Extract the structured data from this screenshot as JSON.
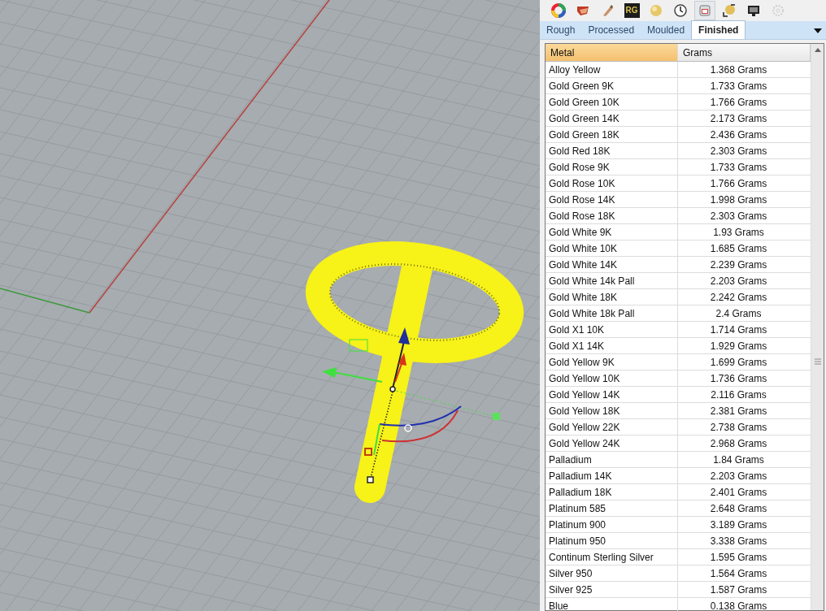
{
  "toolbar": [
    {
      "kind": "palette",
      "selected": false,
      "disabled": false
    },
    {
      "kind": "box",
      "selected": false,
      "disabled": false
    },
    {
      "kind": "brush",
      "selected": false,
      "disabled": false
    },
    {
      "kind": "logo",
      "label": "RG",
      "selected": false,
      "disabled": false
    },
    {
      "kind": "ball",
      "selected": false,
      "disabled": false
    },
    {
      "kind": "clock",
      "selected": false,
      "disabled": false
    },
    {
      "kind": "ring",
      "selected": true,
      "disabled": false
    },
    {
      "kind": "frame",
      "selected": false,
      "disabled": false
    },
    {
      "kind": "monitor",
      "selected": false,
      "disabled": false
    },
    {
      "kind": "gear",
      "selected": false,
      "disabled": true
    }
  ],
  "tabs": [
    {
      "label": "Rough",
      "selected": false
    },
    {
      "label": "Processed",
      "selected": false
    },
    {
      "label": "Moulded",
      "selected": false
    },
    {
      "label": "Finished",
      "selected": true
    }
  ],
  "table": {
    "columns": [
      {
        "label": "Metal",
        "sorted": true
      },
      {
        "label": "Grams",
        "sorted": false
      }
    ],
    "rows": [
      [
        "Alloy Yellow",
        "1.368 Grams"
      ],
      [
        "Gold Green 9K",
        "1.733 Grams"
      ],
      [
        "Gold Green 10K",
        "1.766 Grams"
      ],
      [
        "Gold Green 14K",
        "2.173 Grams"
      ],
      [
        "Gold Green 18K",
        "2.436 Grams"
      ],
      [
        "Gold Red 18K",
        "2.303 Grams"
      ],
      [
        "Gold Rose 9K",
        "1.733 Grams"
      ],
      [
        "Gold Rose 10K",
        "1.766 Grams"
      ],
      [
        "Gold Rose 14K",
        "1.998 Grams"
      ],
      [
        "Gold Rose 18K",
        "2.303 Grams"
      ],
      [
        "Gold White 9K",
        "1.93 Grams"
      ],
      [
        "Gold White 10K",
        "1.685 Grams"
      ],
      [
        "Gold White 14K",
        "2.239 Grams"
      ],
      [
        "Gold White 14k Pall",
        "2.203 Grams"
      ],
      [
        "Gold White 18K",
        "2.242 Grams"
      ],
      [
        "Gold White 18k Pall",
        "2.4 Grams"
      ],
      [
        "Gold X1 10K",
        "1.714 Grams"
      ],
      [
        "Gold X1 14K",
        "1.929 Grams"
      ],
      [
        "Gold Yellow 9K",
        "1.699 Grams"
      ],
      [
        "Gold Yellow 10K",
        "1.736 Grams"
      ],
      [
        "Gold Yellow 14K",
        "2.116 Grams"
      ],
      [
        "Gold Yellow 18K",
        "2.381 Grams"
      ],
      [
        "Gold Yellow 22K",
        "2.738 Grams"
      ],
      [
        "Gold Yellow 24K",
        "2.968 Grams"
      ],
      [
        "Palladium",
        "1.84 Grams"
      ],
      [
        "Palladium 14K",
        "2.203 Grams"
      ],
      [
        "Palladium 18K",
        "2.401 Grams"
      ],
      [
        "Platinum 585",
        "2.648 Grams"
      ],
      [
        "Platinum 900",
        "3.189 Grams"
      ],
      [
        "Platinum 950",
        "3.338 Grams"
      ],
      [
        "Continum Sterling Silver",
        "1.595 Grams"
      ],
      [
        "Silver 950",
        "1.564 Grams"
      ],
      [
        "Silver 925",
        "1.587 Grams"
      ],
      [
        "Blue",
        "0.138 Grams"
      ]
    ]
  }
}
